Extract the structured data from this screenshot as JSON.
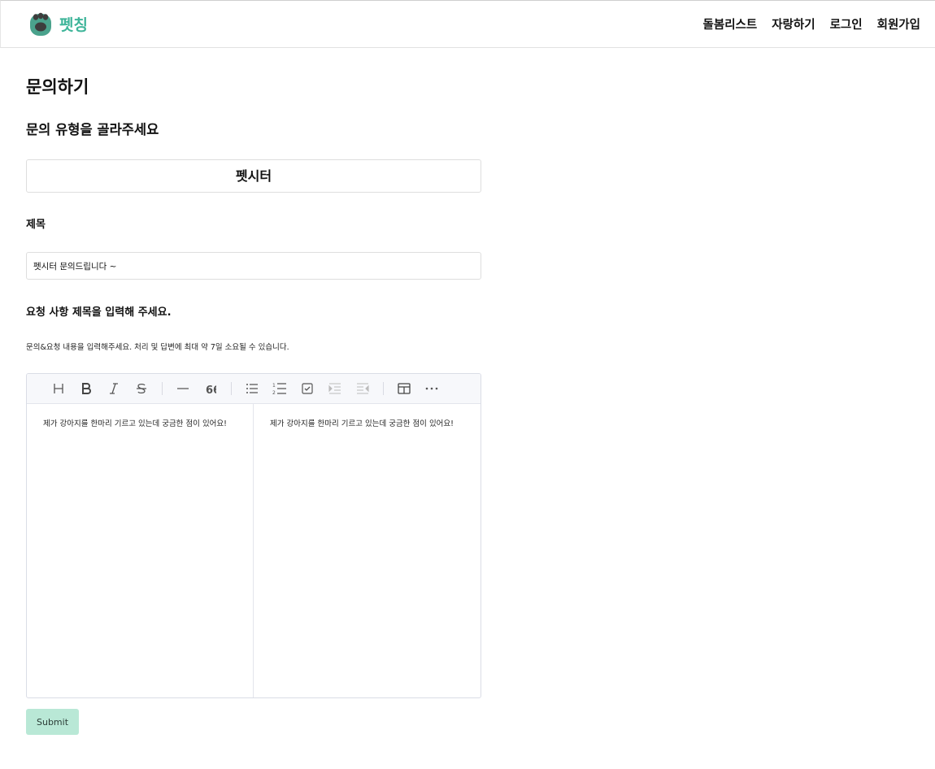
{
  "brand": {
    "name": "펫칭",
    "color": "#3fb59a"
  },
  "nav": {
    "items": [
      "돌봄리스트",
      "자랑하기",
      "로그인",
      "회원가입"
    ]
  },
  "page": {
    "title": "문의하기",
    "type_prompt": "문의 유형을 골라주세요",
    "selected_type": "펫시터",
    "title_label": "제목",
    "title_value": "펫시터 문의드립니다 ~",
    "title_helper": "요청 사항 제목을 입력해 주세요.",
    "content_helper": "문의&요청 내용을 입력해주세요. 처리 및 답변에 최대 약 7일 소요될 수 있습니다."
  },
  "editor": {
    "toolbar": [
      "heading-icon",
      "bold-icon",
      "italic-icon",
      "strike-icon",
      "hr-icon",
      "quote-icon",
      "bullet-list-icon",
      "ordered-list-icon",
      "task-list-icon",
      "indent-icon",
      "outdent-icon",
      "table-icon",
      "more-icon"
    ],
    "markdown_text": "제가 강아지를 한마리 기르고 있는데 궁금한 점이 있어요!",
    "preview_text": "제가 강아지를 한마리 기르고 있는데 궁금한 점이 있어요!"
  },
  "submit": {
    "label": "Submit",
    "color": "#b9e8d6"
  }
}
